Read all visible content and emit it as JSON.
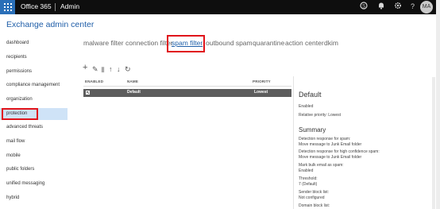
{
  "topbar": {
    "app_name": "Office 365",
    "section": "Admin",
    "avatar_initials": "MA",
    "icons": [
      "skype-icon",
      "bell-icon",
      "gear-icon",
      "help-icon"
    ]
  },
  "header": {
    "title": "Exchange admin center"
  },
  "sidebar": {
    "items": [
      {
        "label": "dashboard"
      },
      {
        "label": "recipients"
      },
      {
        "label": "permissions"
      },
      {
        "label": "compliance management"
      },
      {
        "label": "organization"
      },
      {
        "label": "protection",
        "active": true
      },
      {
        "label": "advanced threats"
      },
      {
        "label": "mail flow"
      },
      {
        "label": "mobile"
      },
      {
        "label": "public folders"
      },
      {
        "label": "unified messaging"
      },
      {
        "label": "hybrid"
      }
    ]
  },
  "tabs": [
    {
      "label": "malware filter"
    },
    {
      "label": "connection filter"
    },
    {
      "label": "spam filter",
      "active": true
    },
    {
      "label": "outbound spam"
    },
    {
      "label": "quarantine"
    },
    {
      "label": "action center"
    },
    {
      "label": "dkim"
    }
  ],
  "toolbar": {
    "add": "+",
    "edit": "✎",
    "delete": "▮",
    "up": "↑",
    "down": "↓",
    "refresh": "↻"
  },
  "table": {
    "columns": [
      "ENABLED",
      "NAME",
      "PRIORITY"
    ],
    "rows": [
      {
        "enabled": true,
        "name": "Default",
        "priority": "Lowest"
      }
    ]
  },
  "details": {
    "title": "Default",
    "status": "Enabled",
    "relative_priority": "Relative priority: Lowest",
    "summary_title": "Summary",
    "items": [
      {
        "label": "Detection response for spam:",
        "value": "Move message to Junk Email folder"
      },
      {
        "label": "Detection response for high confidence spam:",
        "value": "Move message to Junk Email folder"
      },
      {
        "label": "Mark bulk email as spam:",
        "value": "Enabled"
      },
      {
        "label": "Threshold:",
        "value": "7 (Default)"
      },
      {
        "label": "Sender block list:",
        "value": "Not configured"
      }
    ],
    "cutoff": "Domain block list:"
  },
  "colors": {
    "topbar": "#0e0e0e",
    "waffle": "#2a6fb8",
    "accent": "#1f5ea8",
    "highlight_box": "#e0141b",
    "selected_row": "#5d5d5d",
    "sidebar_active": "#cfe3f7"
  }
}
